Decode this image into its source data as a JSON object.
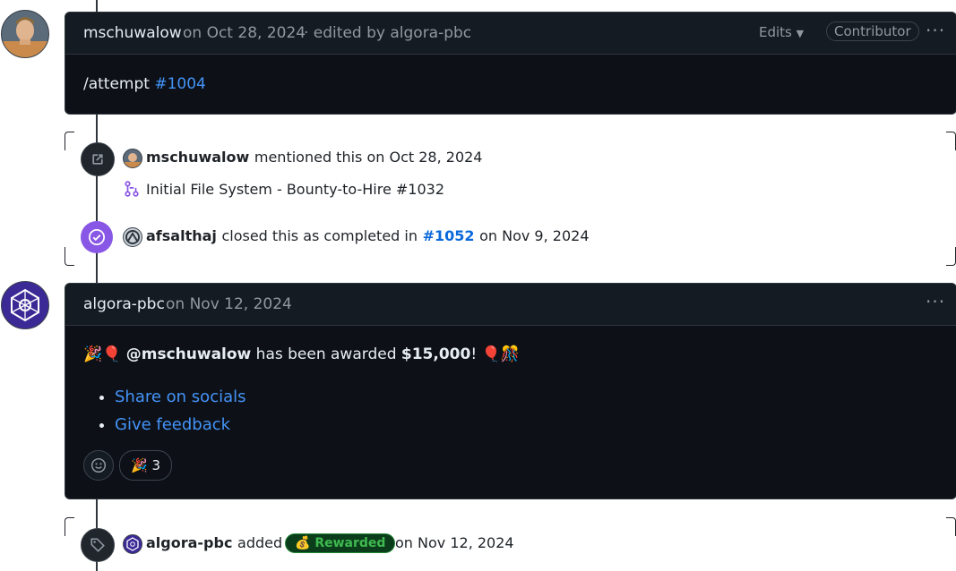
{
  "comment1": {
    "author": "mschuwalow",
    "meta_prefix": "on Oct 28, 2024",
    "meta_edited": "· edited by algora-pbc",
    "edits_label": "Edits",
    "role_badge": "Contributor",
    "body_text": "/attempt",
    "body_link": "#1004"
  },
  "events": {
    "mention": {
      "actor": "mschuwalow",
      "text": "mentioned this on Oct 28, 2024",
      "pr_title": "Initial File System - Bounty-to-Hire #1032"
    },
    "closed": {
      "actor": "afsalthaj",
      "text": "closed this as completed in",
      "link": "#1052",
      "suffix": "on Nov 9, 2024"
    },
    "labeled": {
      "actor": "algora-pbc",
      "text": "added",
      "label": "Rewarded",
      "label_emoji": "💰",
      "suffix": "on Nov 12, 2024"
    }
  },
  "comment2": {
    "author": "algora-pbc",
    "meta": "on Nov 12, 2024",
    "emoji_prefix": "🎉🎈",
    "mention": "@mschuwalow",
    "award_text": "has been awarded",
    "amount": "$15,000",
    "award_suffix": "!",
    "emoji_suffix": "🎈🎊",
    "links": [
      "Share on socials",
      "Give feedback"
    ],
    "reaction_emoji": "🎉",
    "reaction_count": "3"
  },
  "colors": {
    "card_bg": "#0d1117",
    "header_bg": "#151b23",
    "link": "#4493f8",
    "closed_purple": "#8957e5",
    "label_green": "#3fb950"
  }
}
